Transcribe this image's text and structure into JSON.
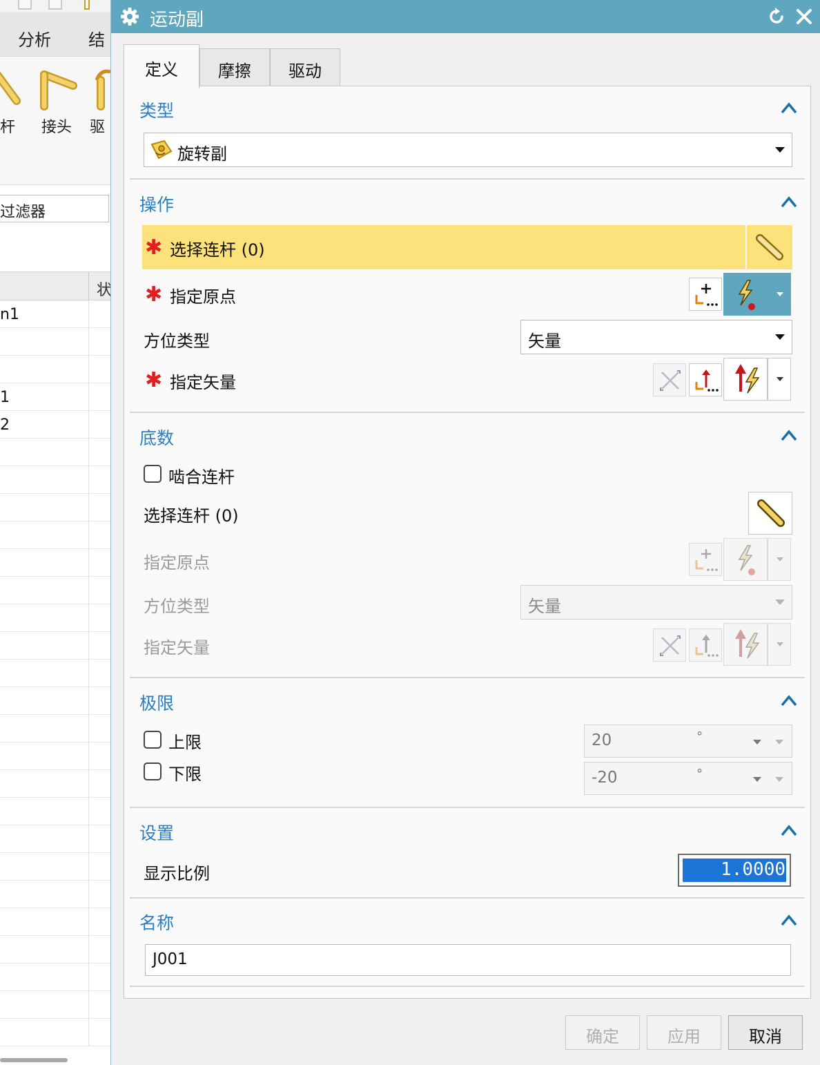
{
  "background_app": {
    "menu_tabs": [
      "分析",
      "结"
    ],
    "ribbon_labels": [
      "杆",
      "接头",
      "驱"
    ],
    "filter_text": "过滤器",
    "grid_header": "状",
    "rows": [
      "n1",
      "",
      "",
      "1",
      "2"
    ]
  },
  "dialog": {
    "title": "运动副",
    "tabs": [
      "定义",
      "摩擦",
      "驱动"
    ],
    "type_section": {
      "title": "类型",
      "selected": "旋转副",
      "icon": "revolute-joint-icon"
    },
    "action_section": {
      "title": "操作",
      "select_link": "选择连杆 (0)",
      "specify_origin": "指定原点",
      "orientation_type_label": "方位类型",
      "orientation_type_value": "矢量",
      "specify_vector": "指定矢量",
      "required_mark": "✱"
    },
    "base_section": {
      "title": "底数",
      "snap_link": "啮合连杆",
      "select_link": "选择连杆 (0)",
      "specify_origin": "指定原点",
      "orientation_type_label": "方位类型",
      "orientation_type_value": "矢量",
      "specify_vector": "指定矢量"
    },
    "limits_section": {
      "title": "极限",
      "upper_label": "上限",
      "upper_value": "20",
      "lower_label": "下限",
      "lower_value": "-20",
      "unit": "°"
    },
    "settings_section": {
      "title": "设置",
      "display_scale_label": "显示比例",
      "display_scale_value": "1.0000"
    },
    "name_section": {
      "title": "名称",
      "value": "J001"
    },
    "buttons": {
      "ok": "确定",
      "apply": "应用",
      "cancel": "取消"
    }
  },
  "colors": {
    "titlebar": "#5fa6bf",
    "section_title": "#2a7fc4",
    "highlight_row": "#fde17a",
    "required": "#e02020",
    "selection": "#1b74d6"
  }
}
